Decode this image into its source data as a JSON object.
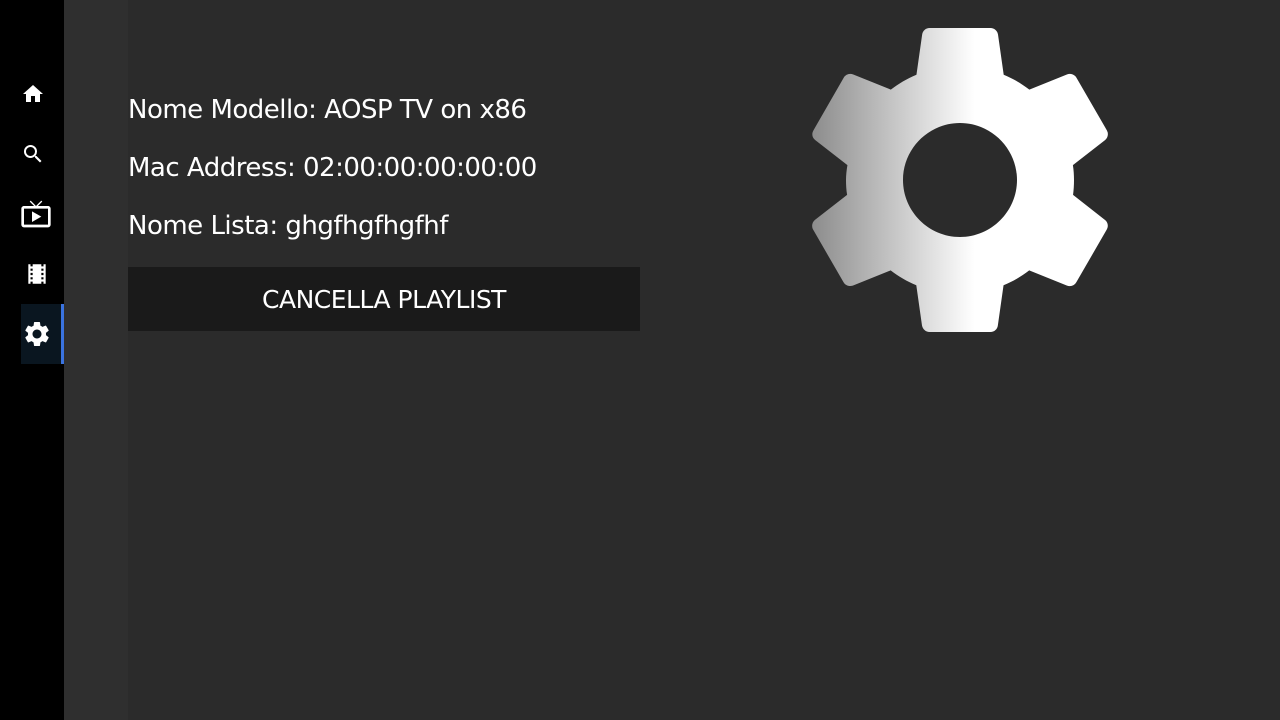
{
  "sidebar": {
    "items": [
      {
        "icon": "home-icon"
      },
      {
        "icon": "search-icon"
      },
      {
        "icon": "live-tv-icon"
      },
      {
        "icon": "movie-icon"
      },
      {
        "icon": "settings-icon",
        "active": true
      }
    ],
    "active_color": "#3a73e0"
  },
  "device_info": {
    "model": "Nome Modello: AOSP TV on x86",
    "mac": "Mac Address: 02:00:00:00:00:00",
    "list_name": "Nome Lista: ghgfhgfhgfhf"
  },
  "actions": {
    "cancel_playlist_label": "CANCELLA PLAYLIST"
  },
  "hero": {
    "icon": "settings-gear-icon"
  },
  "colors": {
    "background": "#2b2b2b",
    "sidebar": "#000000",
    "button": "#1a1a1a",
    "text": "#ffffff"
  }
}
